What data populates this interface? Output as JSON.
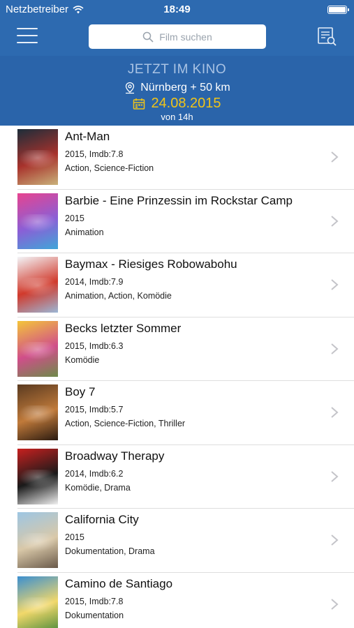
{
  "status_bar": {
    "carrier": "Netzbetreiber",
    "time": "18:49"
  },
  "navbar": {
    "search_placeholder": "Film suchen"
  },
  "header": {
    "title": "JETZT IM KINO",
    "location": "Nürnberg + 50 km",
    "date": "24.08.2015",
    "time": "von 14h"
  },
  "colors": {
    "header_blue": "#2d6ab0",
    "date_yellow": "#f0c419"
  },
  "movies": [
    {
      "title": "Ant-Man",
      "meta": "2015, Imdb:7.8",
      "genres": "Action, Science-Fiction",
      "poster_colors": [
        "#1c2d3a",
        "#a8322c",
        "#c9b27a"
      ]
    },
    {
      "title": "Barbie - Eine Prinzessin im Rockstar Camp",
      "meta": "2015",
      "genres": "Animation",
      "poster_colors": [
        "#e7438f",
        "#8a5fd6",
        "#3fa6d8"
      ]
    },
    {
      "title": "Baymax - Riesiges Robowabohu",
      "meta": "2014, Imdb:7.9",
      "genres": "Animation, Action, Komödie",
      "poster_colors": [
        "#f3f5f8",
        "#d13a2c",
        "#9bb7d6"
      ]
    },
    {
      "title": "Becks letzter Sommer",
      "meta": "2015, Imdb:6.3",
      "genres": "Komödie",
      "poster_colors": [
        "#f4c53a",
        "#d04e8a",
        "#6e8a4a"
      ]
    },
    {
      "title": "Boy 7",
      "meta": "2015, Imdb:5.7",
      "genres": "Action, Science-Fiction, Thriller",
      "poster_colors": [
        "#5a3a20",
        "#c07a3a",
        "#2a1a10"
      ]
    },
    {
      "title": "Broadway Therapy",
      "meta": "2014, Imdb:6.2",
      "genres": "Komödie, Drama",
      "poster_colors": [
        "#c8201f",
        "#1a1a1a",
        "#f1f1f1"
      ]
    },
    {
      "title": "California City",
      "meta": "2015",
      "genres": "Dokumentation, Drama",
      "poster_colors": [
        "#9dc6e3",
        "#d9c8a8",
        "#6a5a4a"
      ]
    },
    {
      "title": "Camino de Santiago",
      "meta": "2015, Imdb:7.8",
      "genres": "Dokumentation",
      "poster_colors": [
        "#3b8fd0",
        "#f2d86a",
        "#4a8a3a"
      ]
    }
  ]
}
